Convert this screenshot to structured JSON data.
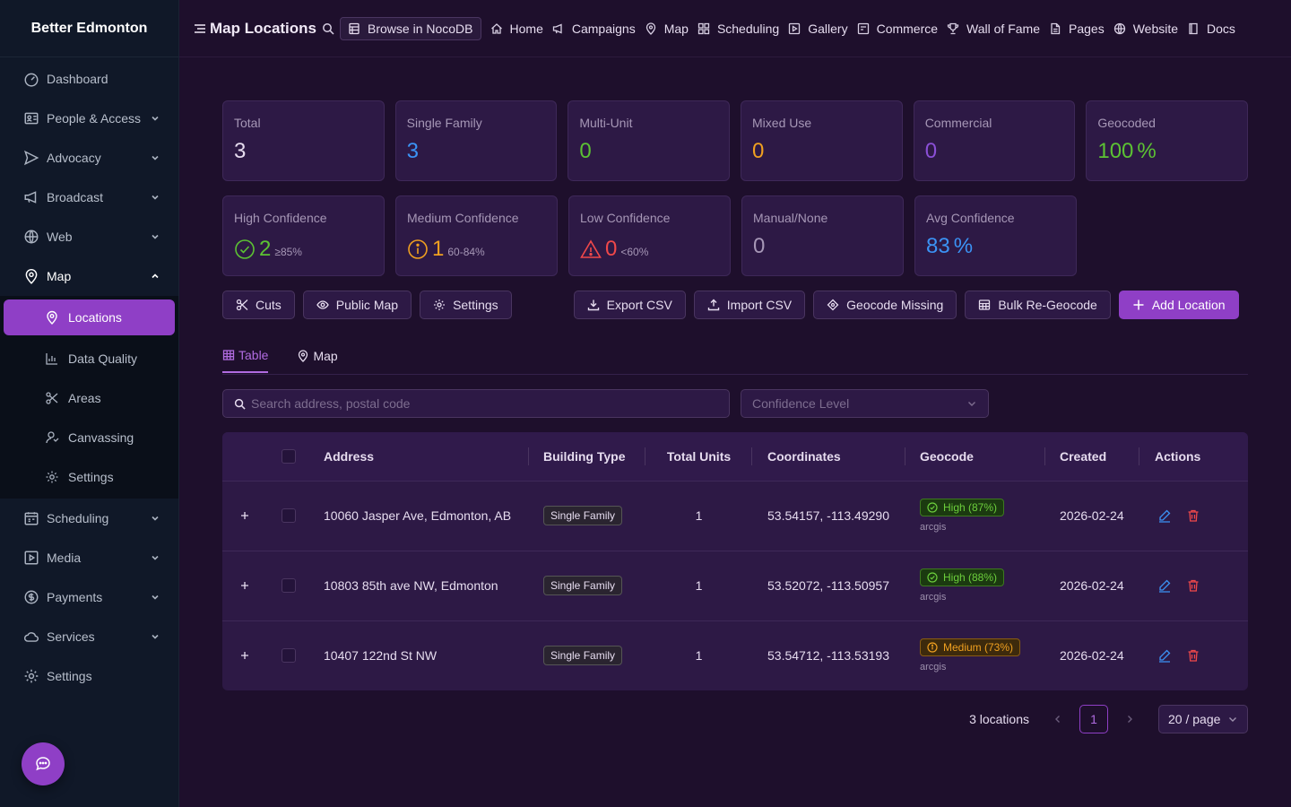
{
  "sidebar": {
    "brand": "Better Edmonton",
    "items": [
      {
        "label": "Dashboard"
      },
      {
        "label": "People & Access"
      },
      {
        "label": "Advocacy"
      },
      {
        "label": "Broadcast"
      },
      {
        "label": "Web"
      },
      {
        "label": "Map"
      },
      {
        "label": "Scheduling"
      },
      {
        "label": "Media"
      },
      {
        "label": "Payments"
      },
      {
        "label": "Services"
      },
      {
        "label": "Settings"
      }
    ],
    "map_sub": [
      {
        "label": "Locations"
      },
      {
        "label": "Data Quality"
      },
      {
        "label": "Areas"
      },
      {
        "label": "Canvassing"
      },
      {
        "label": "Settings"
      }
    ]
  },
  "topbar": {
    "title": "Map Locations",
    "noco": "Browse in NocoDB",
    "links": [
      "Home",
      "Campaigns",
      "Map",
      "Scheduling",
      "Gallery",
      "Commerce",
      "Wall of Fame",
      "Pages",
      "Website",
      "Docs"
    ]
  },
  "stats": {
    "total": {
      "label": "Total",
      "value": "3"
    },
    "single": {
      "label": "Single Family",
      "value": "3"
    },
    "multi": {
      "label": "Multi-Unit",
      "value": "0"
    },
    "mixed": {
      "label": "Mixed Use",
      "value": "0"
    },
    "commercial": {
      "label": "Commercial",
      "value": "0"
    },
    "geocoded": {
      "label": "Geocoded",
      "value": "100",
      "unit": "%"
    },
    "high": {
      "label": "High Confidence",
      "value": "2",
      "sub": "≥85%"
    },
    "medium": {
      "label": "Medium Confidence",
      "value": "1",
      "sub": "60-84%"
    },
    "low": {
      "label": "Low Confidence",
      "value": "0",
      "sub": "<60%"
    },
    "manual": {
      "label": "Manual/None",
      "value": "0"
    },
    "avg": {
      "label": "Avg Confidence",
      "value": "83",
      "unit": "%"
    }
  },
  "toolbar": {
    "cuts": "Cuts",
    "public_map": "Public Map",
    "settings": "Settings",
    "export": "Export CSV",
    "import": "Import CSV",
    "geocode_missing": "Geocode Missing",
    "bulk": "Bulk Re-Geocode",
    "add": "Add Location"
  },
  "tabs": {
    "table": "Table",
    "map": "Map"
  },
  "filters": {
    "search_placeholder": "Search address, postal code",
    "confidence_placeholder": "Confidence Level"
  },
  "table": {
    "headers": {
      "address": "Address",
      "type": "Building Type",
      "units": "Total Units",
      "coords": "Coordinates",
      "geocode": "Geocode",
      "created": "Created",
      "actions": "Actions"
    },
    "rows": [
      {
        "address": "10060 Jasper Ave, Edmonton, AB",
        "type": "Single Family",
        "units": "1",
        "coords": "53.54157, -113.49290",
        "geocode": "High (87%)",
        "level": "high",
        "source": "arcgis",
        "created": "2026-02-24"
      },
      {
        "address": "10803 85th ave NW, Edmonton",
        "type": "Single Family",
        "units": "1",
        "coords": "53.52072, -113.50957",
        "geocode": "High (88%)",
        "level": "high",
        "source": "arcgis",
        "created": "2026-02-24"
      },
      {
        "address": "10407 122nd St NW",
        "type": "Single Family",
        "units": "1",
        "coords": "53.54712, -113.53193",
        "geocode": "Medium (73%)",
        "level": "medium",
        "source": "arcgis",
        "created": "2026-02-24"
      }
    ]
  },
  "pagination": {
    "total": "3 locations",
    "page": "1",
    "size": "20 / page"
  },
  "colors": {
    "accent": "#8f3fc6",
    "blue": "#3b93f5",
    "green": "#5cc233",
    "orange": "#f0a020",
    "red": "#f0484a"
  }
}
